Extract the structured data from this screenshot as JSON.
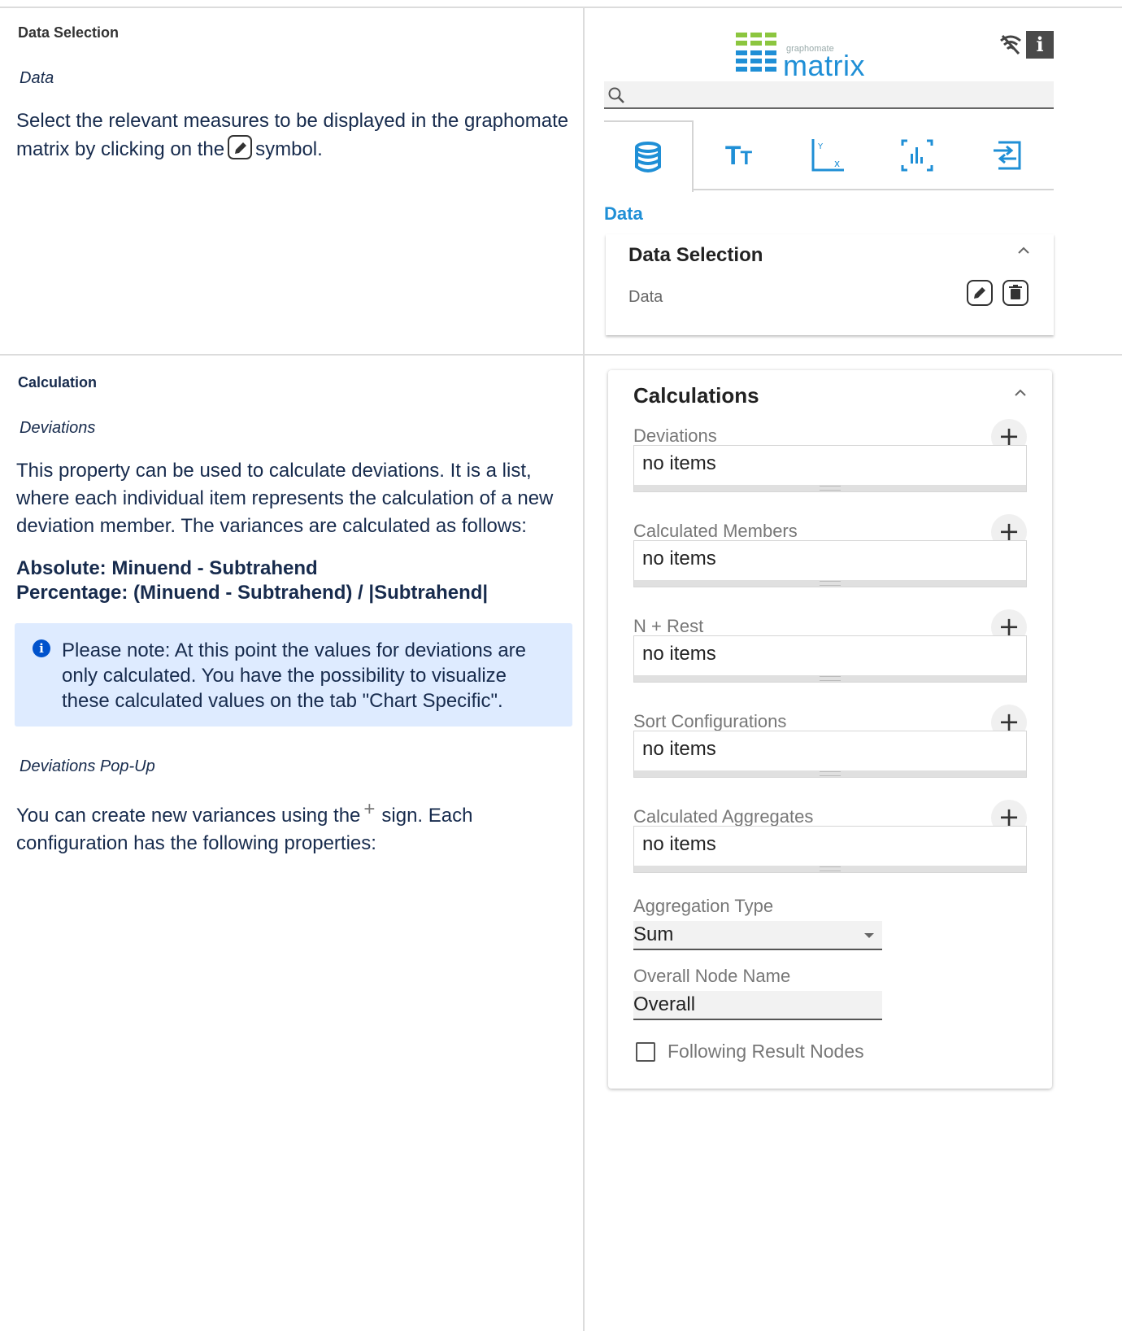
{
  "row1": {
    "doc": {
      "heading": "Data Selection",
      "subheading": "Data",
      "text_before": "Select the relevant measures to be displayed in the graphomate matrix by clicking on the",
      "text_after": "symbol."
    },
    "panel": {
      "logo_small": "graphomate",
      "logo_big": "matrix",
      "info_button": "i",
      "tabs": [
        "data-tab",
        "text-tab",
        "axis-tab",
        "chart-tab",
        "export-tab"
      ],
      "tab_text_glyph": "T",
      "tab_text_glyph_small": "T",
      "section_label": "Data",
      "card_title": "Data Selection",
      "field_label": "Data"
    }
  },
  "row2": {
    "doc": {
      "heading": "Calculation",
      "subheading": "Deviations",
      "paragraph": "This property can be used to calculate deviations. It is a list, where each individual item represents the calculation of a new deviation member. The variances are calculated as follows:",
      "formula_absolute": "Absolute: Minuend - Subtrahend",
      "formula_percentage": "Percentage: (Minuend - Subtrahend) / |Subtrahend|",
      "note": "Please note: At this point the values for deviations are only calculated. You have the possibility to visualize these calculated values on the tab \"Chart Specific\".",
      "subheading2": "Deviations Pop-Up",
      "text2_before": "You can create new variances using the",
      "text2_after": "sign. Each configuration has the following properties:"
    },
    "panel": {
      "card_title": "Calculations",
      "groups": [
        {
          "label": "Deviations",
          "value": "no items"
        },
        {
          "label": "Calculated Members",
          "value": "no items"
        },
        {
          "label": "N + Rest",
          "value": "no items"
        },
        {
          "label": "Sort Configurations",
          "value": "no items"
        },
        {
          "label": "Calculated Aggregates",
          "value": "no items"
        }
      ],
      "plus_symbol": "+",
      "aggregation_label": "Aggregation Type",
      "aggregation_value": "Sum",
      "overall_label": "Overall Node Name",
      "overall_value": "Overall",
      "checkbox_label": "Following Result Nodes"
    }
  },
  "colors": {
    "accent": "#1f8fd6",
    "note_bg": "#deebff",
    "info_icon": "#0052cc",
    "text": "#172b4d"
  },
  "icons": [
    "edit-icon",
    "trash-icon",
    "search-icon",
    "wifi-off-icon",
    "info-icon",
    "database-icon",
    "text-size-icon",
    "axis-icon",
    "chart-icon",
    "export-icon",
    "chevron-up-icon",
    "plus-icon",
    "dropdown-arrow-icon",
    "checkbox-icon"
  ]
}
